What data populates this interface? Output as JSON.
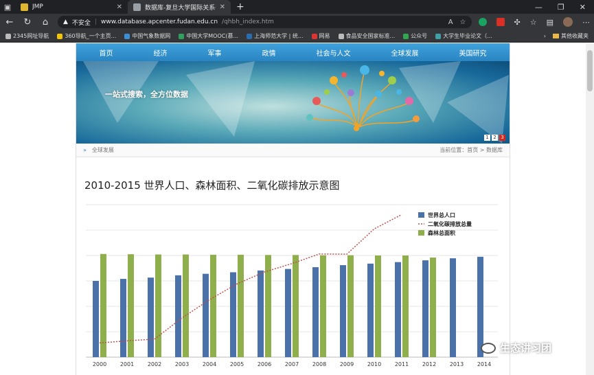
{
  "browser": {
    "tabs": [
      {
        "title": "JMP",
        "active": false
      },
      {
        "title": "数据库-复旦大学国际关系研究院",
        "active": true
      }
    ],
    "security_label": "不安全",
    "url_host": "www.database.apcenter.fudan.edu.cn",
    "url_path": "/qhbh_index.htm",
    "bookmarks": [
      "2345网址导航",
      "360导航_一个主页...",
      "中国气象数据网",
      "中国大学MOOC(慕...",
      "上海师范大学 | 统...",
      "网易",
      "食品安全国家标准...",
      "公众号",
      "大学生毕业论文（..."
    ],
    "other_bookmarks": "其他收藏夹"
  },
  "nav": [
    "首页",
    "经济",
    "军事",
    "政情",
    "社会与人文",
    "全球发展",
    "美国研究"
  ],
  "banner": {
    "slogan": "一站式搜索，全方位数据",
    "pages": [
      "1",
      "2",
      "3"
    ],
    "active_page": "3"
  },
  "breadcrumb": {
    "section": "全球发展",
    "location_label": "当前位置：",
    "path": "首页 > 数据库"
  },
  "page_title": "2010-2015 世界人口、森林面积、二氧化碳排放示意图",
  "watermark": "生态讲习团",
  "chart_data": {
    "type": "bar",
    "categories": [
      "2000",
      "2001",
      "2002",
      "2003",
      "2004",
      "2005",
      "2006",
      "2007",
      "2008",
      "2009",
      "2010",
      "2011",
      "2012",
      "2013",
      "2014"
    ],
    "series": [
      {
        "name": "世界总人口",
        "kind": "bar",
        "color": "#4a72a8",
        "values": [
          30,
          30.8,
          31.3,
          32.2,
          32.8,
          33.4,
          34.1,
          34.7,
          35.4,
          36.2,
          36.8,
          37.4,
          38.1,
          38.9,
          39.5
        ]
      },
      {
        "name": "二氧化碳排放总量",
        "kind": "line",
        "color": "#c0504d",
        "values": [
          5.6,
          6.4,
          7.1,
          15.4,
          22.6,
          28.8,
          33.5,
          36.8,
          40.6,
          40.5,
          50.5,
          56.1
        ]
      },
      {
        "name": "森林总面积",
        "kind": "bar",
        "color": "#8faf4c",
        "values": [
          40.6,
          40.5,
          40.4,
          40.4,
          40.3,
          40.3,
          40.2,
          40.2,
          40.1,
          40.1,
          40.0,
          40.0,
          39.2
        ]
      }
    ],
    "ylim": [
      0,
      60
    ],
    "grid": true,
    "legend_position": "top-right"
  }
}
